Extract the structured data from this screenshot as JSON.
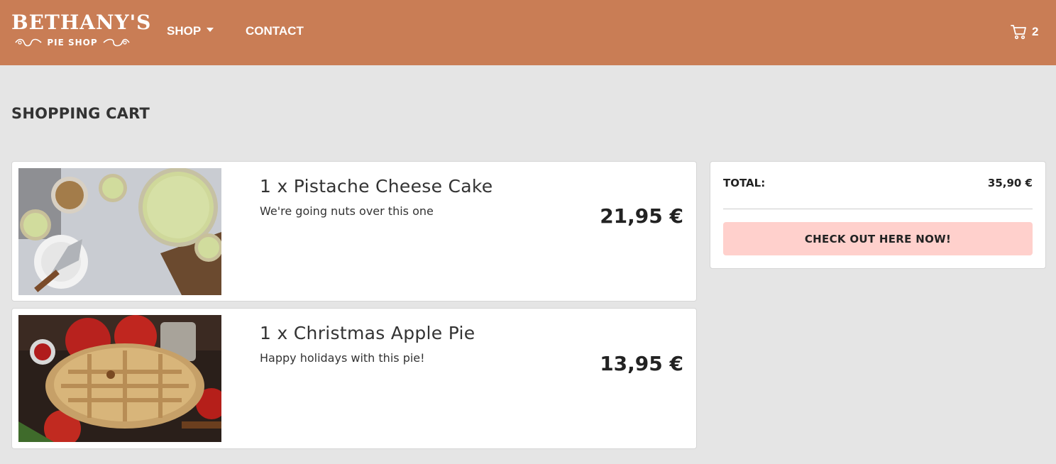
{
  "header": {
    "logo_title": "BETHANY'S",
    "logo_subtitle": "PIE SHOP",
    "nav": [
      {
        "label": "SHOP"
      },
      {
        "label": "CONTACT"
      }
    ],
    "cart_count": "2",
    "cart_icon": "shopping-cart-icon",
    "background_color": "#c97d55"
  },
  "page": {
    "title": "SHOPPING CART"
  },
  "cart": {
    "items": [
      {
        "name": "1 x Pistache Cheese Cake",
        "description": "We're going nuts over this one",
        "price": "21,95 €",
        "image": "pistachio-cheesecake-photo"
      },
      {
        "name": "1 x Christmas Apple Pie",
        "description": "Happy holidays with this pie!",
        "price": "13,95 €",
        "image": "christmas-apple-pie-photo"
      }
    ],
    "summary": {
      "total_label": "TOTAL:",
      "total_value": "35,90 €",
      "checkout_label": "CHECK OUT HERE NOW!",
      "checkout_color": "#ffd0cc"
    }
  }
}
